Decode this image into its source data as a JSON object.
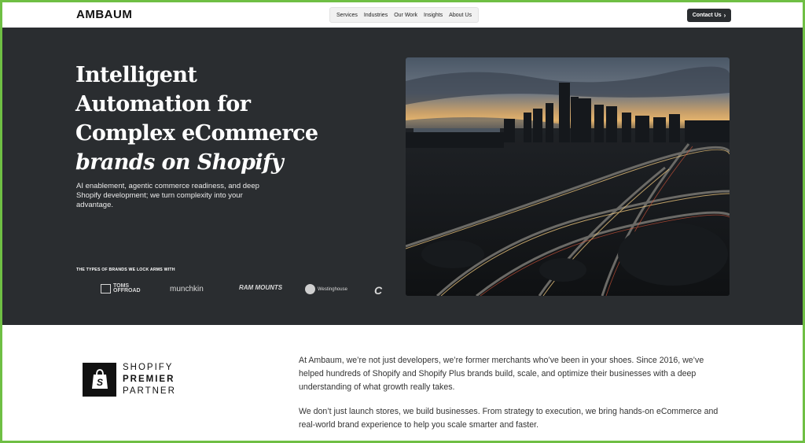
{
  "header": {
    "logo": "AMBAUM",
    "nav": [
      "Services",
      "Industries",
      "Our Work",
      "Insights",
      "About Us"
    ],
    "cta": "Contact Us",
    "cta_icon": "chevron-right-icon"
  },
  "hero": {
    "headline_lines": [
      "Intelligent",
      "Automation for",
      "Complex eCommerce"
    ],
    "headline_italic": "brands on Shopify",
    "subtext": "AI enablement, agentic commerce readiness, and deep Shopify development; we turn complexity into your advantage.",
    "brands_label": "THE TYPES OF BRANDS WE LOCK ARMS WITH",
    "brands": [
      "TOMS OFFROAD",
      "munchkin",
      "RAM MOUNTS",
      "Westinghouse",
      "C"
    ],
    "image_desc_icon": "city-skyline-highway-photo"
  },
  "partner": {
    "line1": "SHOPIFY",
    "line2": "PREMIER",
    "line3": "PARTNER",
    "icon": "shopify-bag-icon"
  },
  "about": {
    "p1": "At Ambaum, we’re not just developers, we’re former merchants who’ve been in your shoes. Since 2016, we’ve helped hundreds of Shopify and Shopify Plus brands build, scale, and optimize their businesses with a deep understanding of what growth really takes.",
    "p2": "We don’t just launch stores, we build businesses. From strategy to execution, we bring hands-on eCommerce and real-world brand experience to help you scale smarter and faster."
  },
  "colors": {
    "hero_bg": "#2a2d30",
    "border": "#6fbf44",
    "cta_bg": "#2a2d30"
  }
}
